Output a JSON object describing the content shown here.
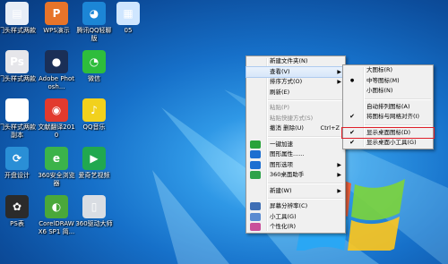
{
  "desktop_icons": [
    {
      "label": "门头样式两款",
      "color": "#e8eef7",
      "glyph": "▤"
    },
    {
      "label": "WPS演示",
      "color": "#e7742a",
      "glyph": "P"
    },
    {
      "label": "腾讯QQ轻聊版",
      "color": "#1c86d6",
      "glyph": "◕"
    },
    {
      "label": "05",
      "color": "#cfe6ff",
      "glyph": "▦"
    },
    {
      "label": "门头样式两款",
      "color": "#e6e6ea",
      "glyph": "Ps"
    },
    {
      "label": "Adobe Photosh...",
      "color": "#1a2f57",
      "glyph": "●"
    },
    {
      "label": "微信",
      "color": "#2ebd3c",
      "glyph": "◔"
    },
    {
      "label": "门头样式两款副本",
      "color": "#ffffff",
      "glyph": "▤"
    },
    {
      "label": "文献翻译2010",
      "color": "#e23a2e",
      "glyph": "◉"
    },
    {
      "label": "QQ音乐",
      "color": "#f2d11c",
      "glyph": "♪"
    },
    {
      "label": "开盘设计",
      "color": "#2a8fd6",
      "glyph": "⟳"
    },
    {
      "label": "360安全浏览器",
      "color": "#3bb34a",
      "glyph": "e"
    },
    {
      "label": "爱奇艺视频",
      "color": "#21a84f",
      "glyph": "▶"
    },
    {
      "label": "PS表",
      "color": "#2b2b2b",
      "glyph": "✿"
    },
    {
      "label": "CorelDRAW X6 SP1 简...",
      "color": "#4aa83a",
      "glyph": "◐"
    },
    {
      "label": "360驱动大师",
      "color": "#d9dde3",
      "glyph": "▯"
    }
  ],
  "context_menu": {
    "items": [
      {
        "label": "新建文件夹(N)",
        "type": "item"
      },
      {
        "label": "查看(V)",
        "type": "submenu",
        "highlight": true
      },
      {
        "label": "排序方式(O)",
        "type": "submenu"
      },
      {
        "label": "刷新(E)",
        "type": "item"
      },
      {
        "type": "sep"
      },
      {
        "label": "粘贴(P)",
        "type": "item",
        "disabled": true
      },
      {
        "label": "粘贴快捷方式(S)",
        "type": "item",
        "disabled": true
      },
      {
        "label": "撤消 删除(U)",
        "type": "item",
        "shortcut": "Ctrl+Z"
      },
      {
        "type": "sep"
      },
      {
        "label": "一键加速",
        "type": "item",
        "icon": "speedup-icon"
      },
      {
        "label": "图形属性......",
        "type": "item",
        "icon": "graphics-properties-icon"
      },
      {
        "label": "图形选项",
        "type": "submenu",
        "icon": "graphics-options-icon"
      },
      {
        "label": "360桌面助手",
        "type": "submenu",
        "icon": "desktop-assistant-icon"
      },
      {
        "type": "sep"
      },
      {
        "label": "新建(W)",
        "type": "submenu"
      },
      {
        "type": "sep"
      },
      {
        "label": "屏幕分辨率(C)",
        "type": "item",
        "icon": "screen-resolution-icon"
      },
      {
        "label": "小工具(G)",
        "type": "item",
        "icon": "gadgets-icon"
      },
      {
        "label": "个性化(R)",
        "type": "item",
        "icon": "personalize-icon"
      }
    ]
  },
  "view_submenu": {
    "items": [
      {
        "label": "大图标(R)",
        "type": "item"
      },
      {
        "label": "中等图标(M)",
        "type": "item",
        "radio": true
      },
      {
        "label": "小图标(N)",
        "type": "item"
      },
      {
        "type": "sep"
      },
      {
        "label": "自动排列图标(A)",
        "type": "item"
      },
      {
        "label": "将图标与网格对齐(I)",
        "type": "item",
        "check": true
      },
      {
        "type": "sep"
      },
      {
        "label": "显示桌面图标(D)",
        "type": "item",
        "check": true,
        "boxed": true
      },
      {
        "label": "显示桌面小工具(G)",
        "type": "item",
        "check": true
      }
    ]
  },
  "colors": {
    "highlight_box": "#e0202a"
  }
}
